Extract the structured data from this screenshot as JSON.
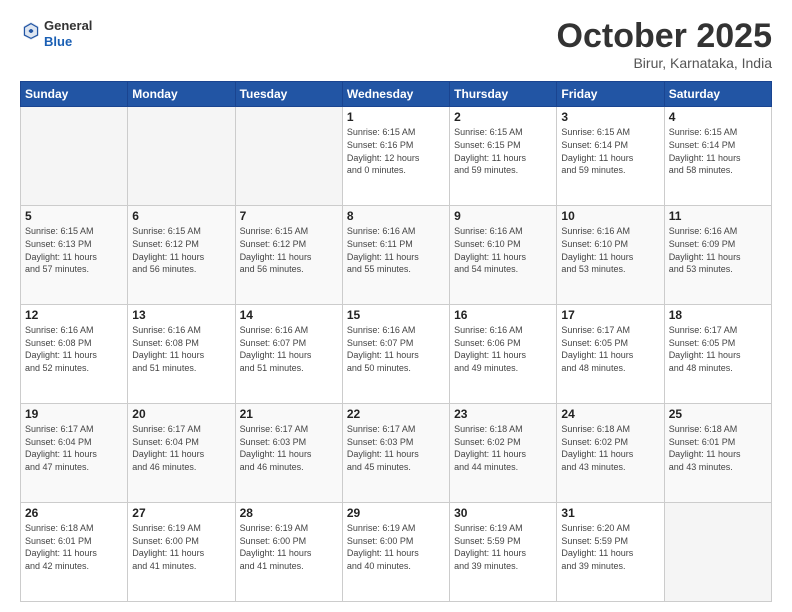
{
  "header": {
    "logo_general": "General",
    "logo_blue": "Blue",
    "month": "October 2025",
    "location": "Birur, Karnataka, India"
  },
  "weekdays": [
    "Sunday",
    "Monday",
    "Tuesday",
    "Wednesday",
    "Thursday",
    "Friday",
    "Saturday"
  ],
  "weeks": [
    [
      {
        "day": "",
        "info": ""
      },
      {
        "day": "",
        "info": ""
      },
      {
        "day": "",
        "info": ""
      },
      {
        "day": "1",
        "info": "Sunrise: 6:15 AM\nSunset: 6:16 PM\nDaylight: 12 hours\nand 0 minutes."
      },
      {
        "day": "2",
        "info": "Sunrise: 6:15 AM\nSunset: 6:15 PM\nDaylight: 11 hours\nand 59 minutes."
      },
      {
        "day": "3",
        "info": "Sunrise: 6:15 AM\nSunset: 6:14 PM\nDaylight: 11 hours\nand 59 minutes."
      },
      {
        "day": "4",
        "info": "Sunrise: 6:15 AM\nSunset: 6:14 PM\nDaylight: 11 hours\nand 58 minutes."
      }
    ],
    [
      {
        "day": "5",
        "info": "Sunrise: 6:15 AM\nSunset: 6:13 PM\nDaylight: 11 hours\nand 57 minutes."
      },
      {
        "day": "6",
        "info": "Sunrise: 6:15 AM\nSunset: 6:12 PM\nDaylight: 11 hours\nand 56 minutes."
      },
      {
        "day": "7",
        "info": "Sunrise: 6:15 AM\nSunset: 6:12 PM\nDaylight: 11 hours\nand 56 minutes."
      },
      {
        "day": "8",
        "info": "Sunrise: 6:16 AM\nSunset: 6:11 PM\nDaylight: 11 hours\nand 55 minutes."
      },
      {
        "day": "9",
        "info": "Sunrise: 6:16 AM\nSunset: 6:10 PM\nDaylight: 11 hours\nand 54 minutes."
      },
      {
        "day": "10",
        "info": "Sunrise: 6:16 AM\nSunset: 6:10 PM\nDaylight: 11 hours\nand 53 minutes."
      },
      {
        "day": "11",
        "info": "Sunrise: 6:16 AM\nSunset: 6:09 PM\nDaylight: 11 hours\nand 53 minutes."
      }
    ],
    [
      {
        "day": "12",
        "info": "Sunrise: 6:16 AM\nSunset: 6:08 PM\nDaylight: 11 hours\nand 52 minutes."
      },
      {
        "day": "13",
        "info": "Sunrise: 6:16 AM\nSunset: 6:08 PM\nDaylight: 11 hours\nand 51 minutes."
      },
      {
        "day": "14",
        "info": "Sunrise: 6:16 AM\nSunset: 6:07 PM\nDaylight: 11 hours\nand 51 minutes."
      },
      {
        "day": "15",
        "info": "Sunrise: 6:16 AM\nSunset: 6:07 PM\nDaylight: 11 hours\nand 50 minutes."
      },
      {
        "day": "16",
        "info": "Sunrise: 6:16 AM\nSunset: 6:06 PM\nDaylight: 11 hours\nand 49 minutes."
      },
      {
        "day": "17",
        "info": "Sunrise: 6:17 AM\nSunset: 6:05 PM\nDaylight: 11 hours\nand 48 minutes."
      },
      {
        "day": "18",
        "info": "Sunrise: 6:17 AM\nSunset: 6:05 PM\nDaylight: 11 hours\nand 48 minutes."
      }
    ],
    [
      {
        "day": "19",
        "info": "Sunrise: 6:17 AM\nSunset: 6:04 PM\nDaylight: 11 hours\nand 47 minutes."
      },
      {
        "day": "20",
        "info": "Sunrise: 6:17 AM\nSunset: 6:04 PM\nDaylight: 11 hours\nand 46 minutes."
      },
      {
        "day": "21",
        "info": "Sunrise: 6:17 AM\nSunset: 6:03 PM\nDaylight: 11 hours\nand 46 minutes."
      },
      {
        "day": "22",
        "info": "Sunrise: 6:17 AM\nSunset: 6:03 PM\nDaylight: 11 hours\nand 45 minutes."
      },
      {
        "day": "23",
        "info": "Sunrise: 6:18 AM\nSunset: 6:02 PM\nDaylight: 11 hours\nand 44 minutes."
      },
      {
        "day": "24",
        "info": "Sunrise: 6:18 AM\nSunset: 6:02 PM\nDaylight: 11 hours\nand 43 minutes."
      },
      {
        "day": "25",
        "info": "Sunrise: 6:18 AM\nSunset: 6:01 PM\nDaylight: 11 hours\nand 43 minutes."
      }
    ],
    [
      {
        "day": "26",
        "info": "Sunrise: 6:18 AM\nSunset: 6:01 PM\nDaylight: 11 hours\nand 42 minutes."
      },
      {
        "day": "27",
        "info": "Sunrise: 6:19 AM\nSunset: 6:00 PM\nDaylight: 11 hours\nand 41 minutes."
      },
      {
        "day": "28",
        "info": "Sunrise: 6:19 AM\nSunset: 6:00 PM\nDaylight: 11 hours\nand 41 minutes."
      },
      {
        "day": "29",
        "info": "Sunrise: 6:19 AM\nSunset: 6:00 PM\nDaylight: 11 hours\nand 40 minutes."
      },
      {
        "day": "30",
        "info": "Sunrise: 6:19 AM\nSunset: 5:59 PM\nDaylight: 11 hours\nand 39 minutes."
      },
      {
        "day": "31",
        "info": "Sunrise: 6:20 AM\nSunset: 5:59 PM\nDaylight: 11 hours\nand 39 minutes."
      },
      {
        "day": "",
        "info": ""
      }
    ]
  ]
}
